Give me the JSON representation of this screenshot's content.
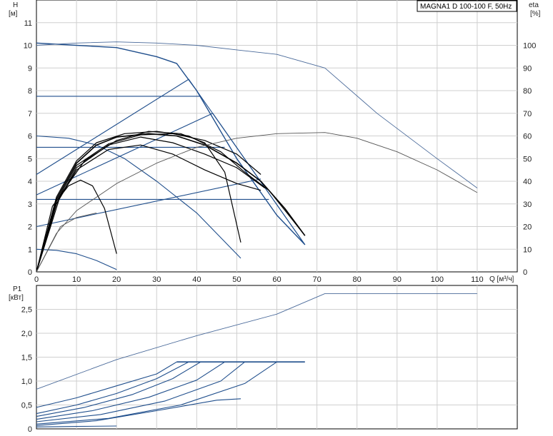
{
  "chart_data": [
    {
      "type": "line",
      "panel": "head_efficiency",
      "title": "MAGNA1 D 100-100 F, 50Hz",
      "ylabel_left": "H",
      "ylabel_left_unit": "[м]",
      "ylabel_right": "eta",
      "ylabel_right_unit": "[%]",
      "xlabel": "Q [м³/ч]",
      "xlim": [
        0,
        120
      ],
      "ylim_left": [
        0,
        12
      ],
      "ylim_right": [
        0,
        120
      ],
      "x_ticks": [
        "0",
        "10",
        "20",
        "30",
        "40",
        "50",
        "60",
        "70",
        "80",
        "90",
        "100",
        "110"
      ],
      "y_left_ticks": [
        "0",
        "1",
        "2",
        "3",
        "4",
        "5",
        "6",
        "7",
        "8",
        "9",
        "10",
        "11"
      ],
      "y_right_ticks": [
        "0",
        "10",
        "20",
        "30",
        "40",
        "50",
        "60",
        "70",
        "80",
        "90",
        "100"
      ],
      "grid": true,
      "colors": {
        "blue": "#1f4e8c",
        "black": "#000000",
        "steel": "#4a6a9a",
        "grey": "#555555"
      },
      "series": [
        {
          "kind": "max-curve",
          "color": "blue",
          "width": 1.4,
          "points": [
            [
              0,
              10.1
            ],
            [
              10,
              10.0
            ],
            [
              20,
              9.9
            ],
            [
              30,
              9.5
            ],
            [
              35,
              9.2
            ],
            [
              40,
              8.0
            ],
            [
              50,
              5.0
            ],
            [
              60,
              2.5
            ],
            [
              67,
              1.2
            ]
          ]
        },
        {
          "kind": "prop-pressure",
          "color": "blue",
          "width": 1.1,
          "points": [
            [
              0,
              4.3
            ],
            [
              38,
              8.5
            ],
            [
              67,
              1.2
            ]
          ]
        },
        {
          "kind": "prop-pressure",
          "color": "blue",
          "width": 1.1,
          "points": [
            [
              0,
              3.4
            ],
            [
              44,
              7.0
            ],
            [
              67,
              1.2
            ]
          ]
        },
        {
          "kind": "prop-pressure",
          "color": "blue",
          "width": 1.1,
          "points": [
            [
              0,
              2.0
            ],
            [
              56,
              4.1
            ]
          ]
        },
        {
          "kind": "const-pressure",
          "color": "blue",
          "width": 1.1,
          "points": [
            [
              0,
              7.75
            ],
            [
              41,
              7.75
            ]
          ]
        },
        {
          "kind": "const-pressure",
          "color": "blue",
          "width": 1.1,
          "points": [
            [
              0,
              5.5
            ],
            [
              47,
              5.5
            ]
          ]
        },
        {
          "kind": "const-pressure",
          "color": "blue",
          "width": 1.1,
          "points": [
            [
              0,
              3.2
            ],
            [
              58,
              3.2
            ]
          ]
        },
        {
          "kind": "min-curve",
          "color": "blue",
          "width": 1.1,
          "points": [
            [
              0,
              6.0
            ],
            [
              8,
              5.9
            ],
            [
              15,
              5.6
            ],
            [
              22,
              5.0
            ],
            [
              30,
              4.0
            ],
            [
              40,
              2.6
            ],
            [
              51,
              0.6
            ]
          ]
        },
        {
          "kind": "min-curve",
          "color": "blue",
          "width": 1.1,
          "points": [
            [
              0,
              1.0
            ],
            [
              5,
              0.95
            ],
            [
              10,
              0.8
            ],
            [
              15,
              0.5
            ],
            [
              20,
              0.1
            ]
          ]
        },
        {
          "kind": "setpoint",
          "color": "black",
          "width": 1.6,
          "points": [
            [
              0,
              0
            ],
            [
              5,
              3.2
            ],
            [
              10,
              4.8
            ],
            [
              15,
              5.6
            ],
            [
              20,
              5.95
            ],
            [
              28,
              6.1
            ],
            [
              35,
              6.0
            ],
            [
              42,
              5.6
            ],
            [
              50,
              4.8
            ],
            [
              56,
              4.0
            ],
            [
              62,
              2.8
            ],
            [
              67,
              1.6
            ]
          ]
        },
        {
          "kind": "setpoint",
          "color": "black",
          "width": 1.2,
          "points": [
            [
              0,
              0
            ],
            [
              5,
              3.3
            ],
            [
              10,
              4.9
            ],
            [
              15,
              5.7
            ],
            [
              22,
              6.1
            ],
            [
              30,
              6.2
            ],
            [
              38,
              6.0
            ],
            [
              46,
              5.3
            ],
            [
              52,
              4.4
            ],
            [
              58,
              3.6
            ],
            [
              63,
              2.5
            ],
            [
              67,
              1.6
            ]
          ]
        },
        {
          "kind": "setpoint",
          "color": "black",
          "width": 1.2,
          "points": [
            [
              0,
              0
            ],
            [
              5,
              3.0
            ],
            [
              10,
              4.6
            ],
            [
              18,
              5.6
            ],
            [
              26,
              5.95
            ],
            [
              34,
              5.7
            ],
            [
              42,
              5.2
            ],
            [
              50,
              4.6
            ],
            [
              57,
              3.7
            ]
          ]
        },
        {
          "kind": "setpoint",
          "color": "black",
          "width": 1.2,
          "points": [
            [
              0,
              0
            ],
            [
              5,
              3.1
            ],
            [
              10,
              4.7
            ],
            [
              18,
              5.65
            ],
            [
              26,
              6.05
            ],
            [
              34,
              6.1
            ],
            [
              42,
              5.8
            ],
            [
              50,
              5.2
            ],
            [
              56,
              4.3
            ]
          ]
        },
        {
          "kind": "setpoint",
          "color": "black",
          "width": 1.2,
          "points": [
            [
              0,
              0
            ],
            [
              5,
              3.0
            ],
            [
              10,
              4.5
            ],
            [
              18,
              5.4
            ],
            [
              26,
              5.6
            ],
            [
              34,
              5.2
            ],
            [
              42,
              4.5
            ],
            [
              50,
              3.9
            ],
            [
              56,
              3.6
            ]
          ]
        },
        {
          "kind": "setpoint",
          "color": "black",
          "width": 1.2,
          "points": [
            [
              0,
              0
            ],
            [
              6,
              3.4
            ],
            [
              12,
              4.9
            ],
            [
              20,
              5.8
            ],
            [
              28,
              6.2
            ],
            [
              36,
              6.1
            ],
            [
              42,
              5.7
            ],
            [
              47,
              4.4
            ],
            [
              51,
              1.3
            ]
          ]
        },
        {
          "kind": "setpoint",
          "color": "black",
          "width": 1.2,
          "points": [
            [
              0,
              0
            ],
            [
              4,
              2.9
            ],
            [
              8,
              3.8
            ],
            [
              11,
              4.05
            ],
            [
              14,
              3.8
            ],
            [
              17,
              2.8
            ],
            [
              20,
              0.8
            ]
          ]
        },
        {
          "kind": "eta",
          "axis": "right",
          "color": "steel",
          "width": 0.9,
          "points": [
            [
              0,
              100
            ],
            [
              10,
              101
            ],
            [
              20,
              101.5
            ],
            [
              30,
              101
            ],
            [
              40,
              100
            ],
            [
              50,
              98
            ],
            [
              60,
              96
            ],
            [
              72,
              90
            ],
            [
              85,
              70
            ],
            [
              100,
              50
            ],
            [
              110,
              37
            ]
          ]
        },
        {
          "kind": "eta",
          "axis": "right",
          "color": "grey",
          "width": 0.9,
          "points": [
            [
              0,
              0
            ],
            [
              5,
              17
            ],
            [
              10,
              27
            ],
            [
              20,
              39
            ],
            [
              30,
              48
            ],
            [
              40,
              55
            ],
            [
              50,
              59
            ],
            [
              60,
              61
            ],
            [
              72,
              61.5
            ],
            [
              80,
              59
            ],
            [
              90,
              53
            ],
            [
              100,
              45
            ],
            [
              110,
              35
            ]
          ]
        },
        {
          "kind": "eta",
          "axis": "right",
          "color": "grey",
          "width": 0.9,
          "points": [
            [
              0,
              0
            ],
            [
              6,
              20
            ],
            [
              10,
              24
            ],
            [
              15,
              26
            ]
          ]
        }
      ]
    },
    {
      "type": "line",
      "panel": "power",
      "ylabel": "P1",
      "ylabel_unit": "[кВт]",
      "xlim": [
        0,
        120
      ],
      "ylim": [
        0,
        3.0
      ],
      "y_ticks": [
        "0",
        "0,5",
        "1,0",
        "1,5",
        "2,0",
        "2,5"
      ],
      "y_tick_values": [
        0,
        0.5,
        1.0,
        1.5,
        2.0,
        2.5
      ],
      "grid": true,
      "series": [
        {
          "color": "blue",
          "width": 1.6,
          "points": [
            [
              35,
              1.4
            ],
            [
              67,
              1.4
            ]
          ]
        },
        {
          "color": "steel",
          "width": 0.9,
          "points": [
            [
              0,
              0.83
            ],
            [
              20,
              1.45
            ],
            [
              40,
              1.95
            ],
            [
              60,
              2.4
            ],
            [
              72,
              2.83
            ],
            [
              110,
              2.83
            ]
          ]
        },
        {
          "color": "blue",
          "width": 1.1,
          "points": [
            [
              0,
              0.45
            ],
            [
              10,
              0.65
            ],
            [
              20,
              0.9
            ],
            [
              30,
              1.15
            ],
            [
              35,
              1.4
            ]
          ]
        },
        {
          "color": "blue",
          "width": 1.1,
          "points": [
            [
              0,
              0.32
            ],
            [
              10,
              0.5
            ],
            [
              20,
              0.74
            ],
            [
              30,
              1.05
            ],
            [
              38,
              1.4
            ]
          ]
        },
        {
          "color": "blue",
          "width": 1.1,
          "points": [
            [
              0,
              0.26
            ],
            [
              12,
              0.45
            ],
            [
              24,
              0.72
            ],
            [
              34,
              1.05
            ],
            [
              41,
              1.4
            ]
          ]
        },
        {
          "color": "blue",
          "width": 1.1,
          "points": [
            [
              0,
              0.2
            ],
            [
              14,
              0.38
            ],
            [
              28,
              0.66
            ],
            [
              40,
              1.02
            ],
            [
              47,
              1.4
            ]
          ]
        },
        {
          "color": "blue",
          "width": 1.1,
          "points": [
            [
              0,
              0.15
            ],
            [
              16,
              0.3
            ],
            [
              32,
              0.58
            ],
            [
              46,
              1.0
            ],
            [
              52,
              1.4
            ]
          ]
        },
        {
          "color": "blue",
          "width": 1.1,
          "points": [
            [
              0,
              0.1
            ],
            [
              18,
              0.22
            ],
            [
              36,
              0.5
            ],
            [
              52,
              0.95
            ],
            [
              60,
              1.4
            ]
          ]
        },
        {
          "color": "blue",
          "width": 1.1,
          "points": [
            [
              0,
              0.07
            ],
            [
              15,
              0.17
            ],
            [
              30,
              0.38
            ],
            [
              45,
              0.6
            ],
            [
              51,
              0.63
            ]
          ]
        },
        {
          "color": "blue",
          "width": 1.1,
          "points": [
            [
              0,
              0.04
            ],
            [
              10,
              0.05
            ],
            [
              20,
              0.06
            ]
          ]
        }
      ]
    }
  ]
}
